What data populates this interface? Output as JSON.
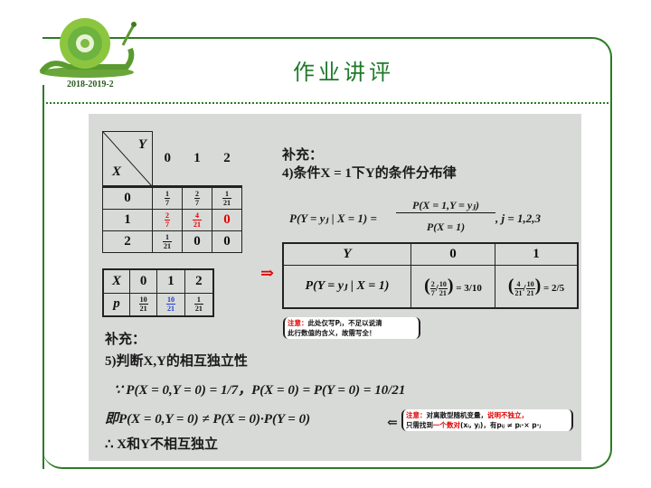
{
  "header": {
    "date": "2018-2019-2",
    "title": "作业讲评"
  },
  "joint_table": {
    "corner_y": "Y",
    "corner_x": "X",
    "col_headers": [
      "0",
      "1",
      "2"
    ],
    "rows": [
      {
        "x": "0",
        "cells": [
          {
            "n": "1",
            "d": "7"
          },
          {
            "n": "2",
            "d": "7"
          },
          {
            "n": "1",
            "d": "21"
          }
        ]
      },
      {
        "x": "1",
        "cells": [
          {
            "n": "2",
            "d": "7"
          },
          {
            "n": "4",
            "d": "21"
          },
          "0"
        ]
      },
      {
        "x": "2",
        "cells": [
          {
            "n": "1",
            "d": "21"
          },
          "0",
          "0"
        ]
      }
    ]
  },
  "marginal_table": {
    "row1": [
      "X",
      "0",
      "1",
      "2"
    ],
    "row2_label": "p",
    "row2": [
      {
        "n": "10",
        "d": "21"
      },
      {
        "n": "10",
        "d": "21"
      },
      {
        "n": "1",
        "d": "21"
      }
    ]
  },
  "supplement_right": {
    "heading": "补充：",
    "line": "4)条件X = 1下Y的条件分布律",
    "formula_left": "P(Y = yⱼ | X = 1) =",
    "formula_num": "P(X = 1,Y = yⱼ)",
    "formula_den": "P(X = 1)",
    "formula_right": ", j = 1,2,3"
  },
  "cond_table": {
    "header": [
      "Y",
      "0",
      "1"
    ],
    "row_label": "P(Y = yⱼ | X = 1)",
    "val0": "3/10",
    "val1": "2/5"
  },
  "arrow": "⇒",
  "note1": {
    "label": "注意：",
    "text1": "此处仅写Pⱼ，不足以说清",
    "text2": "此行数值的含义，故需写全！"
  },
  "supplement_left": {
    "heading": "补充：",
    "line1": "5)判断X,Y的相互独立性",
    "line2": "∵ P(X = 0,Y = 0) = 1/7，P(X = 0) = P(Y = 0) = 10/21",
    "line3": "即P(X = 0,Y = 0) ≠ P(X = 0)·P(Y = 0)",
    "line4": "∴ X和Y不相互独立"
  },
  "note2": {
    "label": "注意：",
    "text1": "对离散型随机变量，",
    "emph1": "说明不独立，",
    "text2a": "只需找到",
    "emph2": "一个数对",
    "text2b": "(xᵢ, yⱼ)，有pᵢⱼ ≠ pᵢ·× p·ⱼ"
  },
  "colors": {
    "frame": "#2d7a26",
    "title": "#1f7a2a",
    "emphasis_red": "#e00000",
    "blue": "#1f3fd6"
  }
}
